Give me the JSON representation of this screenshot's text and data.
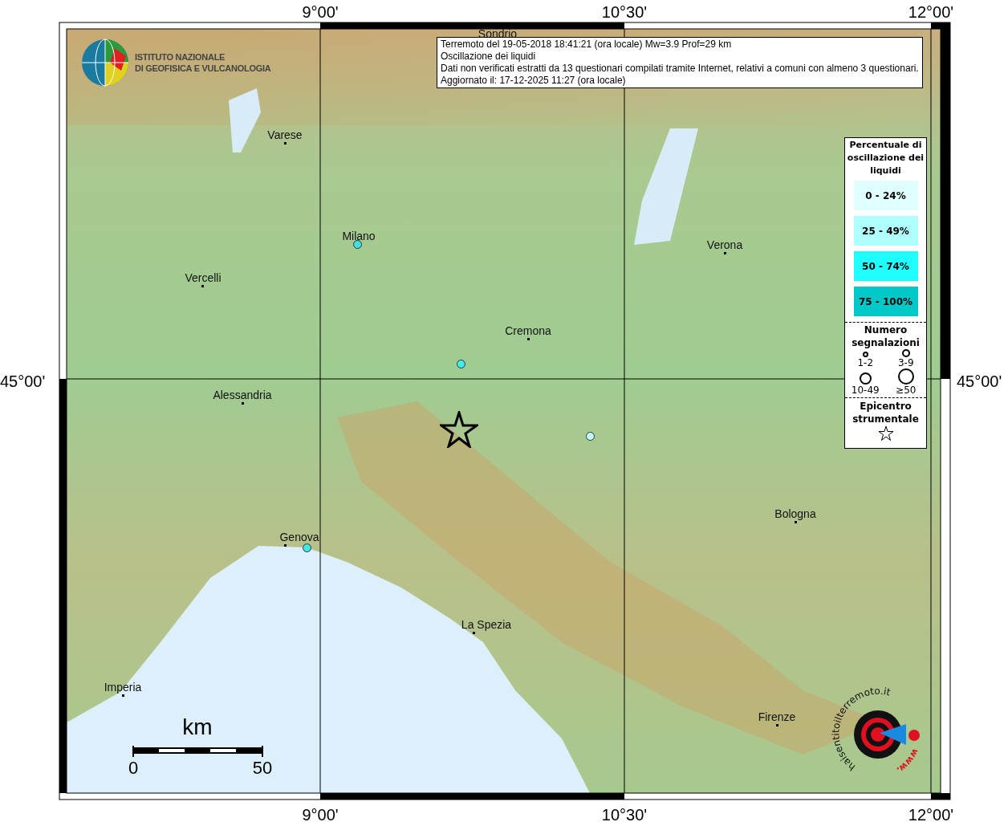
{
  "map": {
    "axis_labels_top": [
      "9°00'",
      "10°30'",
      "12°00'"
    ],
    "axis_labels_bottom": [
      "9°00'",
      "10°30'",
      "12°00'"
    ],
    "axis_label_left": "45°00'",
    "axis_label_right": "45°00'",
    "logo": {
      "lines": [
        "ISTITUTO NAZIONALE",
        "DI GEOFISICA E VULCANOLOGIA"
      ]
    },
    "info_box": {
      "lines": [
        "Terremoto del 19-05-2018 18:41:21 (ora locale) Mw=3.9 Prof=29 km",
        "Oscillazione dei liquidi",
        "Dati non verificati estratti da 13 questionari compilati tramite Internet, relativi a comuni con almeno 3 questionari.",
        "Aggiornato il: 17-12-2025 11:27 (ora locale)"
      ]
    },
    "cities": [
      "Sondrio",
      "Varese",
      "Milano",
      "Verona",
      "Vercelli",
      "Cremona",
      "Alessandria",
      "Bologna",
      "Genova",
      "La Spezia",
      "Imperia",
      "Firenze"
    ],
    "reports": [
      {
        "color": "#40e0e0"
      },
      {
        "color": "#40f0f0"
      },
      {
        "color": "#c0ffff"
      },
      {
        "color": "#40e8e8"
      }
    ],
    "legend": {
      "title": "Percentuale di oscillazione dei liquidi",
      "ranges": [
        {
          "label": "0 - 24%",
          "color": "#e0ffff"
        },
        {
          "label": "25 - 49%",
          "color": "#b0ffff"
        },
        {
          "label": "50 - 74%",
          "color": "#20ffff"
        },
        {
          "label": "75 - 100%",
          "color": "#00c8c8"
        }
      ],
      "count_title": "Numero segnalazioni",
      "counts": [
        "1-2",
        "3-9",
        "10-49",
        "≥50"
      ],
      "epicenter_title": "Epicentro strumentale"
    },
    "scale": {
      "unit": "km",
      "ticks": [
        "0",
        "50"
      ]
    },
    "site_logo": {
      "text": "haisentitoilterremoto.it",
      "prefix": "www."
    }
  }
}
